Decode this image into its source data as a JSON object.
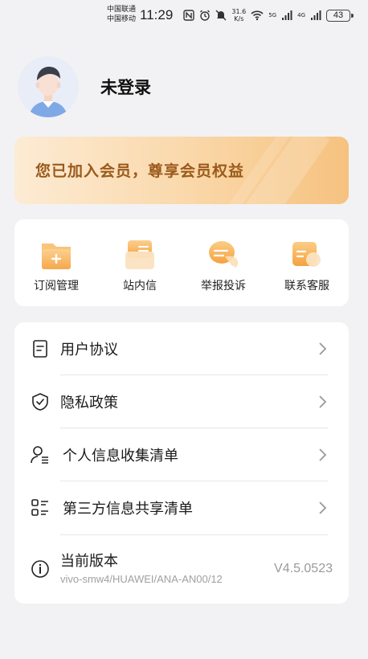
{
  "status_bar": {
    "carrier_1": "中国联通",
    "carrier_2": "中国移动",
    "time": "11:29",
    "net_speed_value": "31.6",
    "net_speed_unit": "K/s",
    "signal_1_label": "5G",
    "signal_2_label": "4G",
    "battery": "43",
    "icons": [
      "nfc-icon",
      "alarm-icon",
      "mute-icon",
      "wifi-icon",
      "signal-icon",
      "battery-icon"
    ]
  },
  "profile": {
    "username": "未登录"
  },
  "member_banner": {
    "text": "您已加入会员，尊享会员权益"
  },
  "quick_actions": [
    {
      "label": "订阅管理",
      "icon": "folder-add-icon"
    },
    {
      "label": "站内信",
      "icon": "message-box-icon"
    },
    {
      "label": "举报投诉",
      "icon": "chat-bubble-icon"
    },
    {
      "label": "联系客服",
      "icon": "customer-service-icon"
    }
  ],
  "menu": {
    "items": [
      {
        "label": "用户协议",
        "icon": "document-icon"
      },
      {
        "label": "隐私政策",
        "icon": "shield-check-icon"
      },
      {
        "label": "个人信息收集清单",
        "icon": "person-list-icon"
      },
      {
        "label": "第三方信息共享清单",
        "icon": "list-grid-icon"
      }
    ],
    "version": {
      "label": "当前版本",
      "detail": "vivo-smw4/HUAWEI/ANA-AN00/12",
      "value": "V4.5.0523",
      "icon": "info-icon"
    }
  },
  "colors": {
    "background": "#f2f2f4",
    "banner_text": "#9a5a1b",
    "accent_orange": "#f7a93b"
  }
}
